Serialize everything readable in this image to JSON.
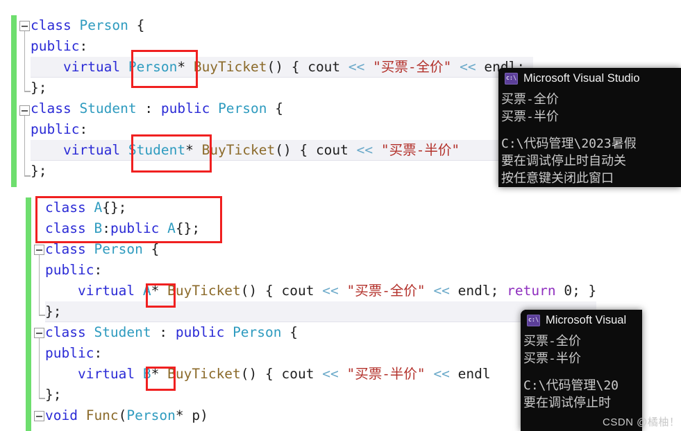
{
  "editor": {
    "block_top": {
      "lines": [
        {
          "id": "l1",
          "segments": [
            {
              "t": "class ",
              "c": "kw"
            },
            {
              "t": "Person",
              "c": "type"
            },
            {
              "t": " {",
              "c": "pn"
            }
          ]
        },
        {
          "id": "l2",
          "segments": [
            {
              "t": "public",
              "c": "kw"
            },
            {
              "t": ":",
              "c": "pn"
            }
          ]
        },
        {
          "id": "l3",
          "segments": [
            {
              "t": "    ",
              "c": "pn"
            },
            {
              "t": "virtual ",
              "c": "kw"
            },
            {
              "t": "Person",
              "c": "type"
            },
            {
              "t": "* ",
              "c": "pn"
            },
            {
              "t": "BuyTicket",
              "c": "fn"
            },
            {
              "t": "() { ",
              "c": "pn"
            },
            {
              "t": "cout",
              "c": "id"
            },
            {
              "t": " ",
              "c": "pn"
            },
            {
              "t": "<<",
              "c": "op"
            },
            {
              "t": " ",
              "c": "pn"
            },
            {
              "t": "\"买票-全价\"",
              "c": "str"
            },
            {
              "t": " ",
              "c": "pn"
            },
            {
              "t": "<<",
              "c": "op"
            },
            {
              "t": " ",
              "c": "pn"
            },
            {
              "t": "endl",
              "c": "id"
            },
            {
              "t": "; ",
              "c": "pn"
            }
          ]
        },
        {
          "id": "l4",
          "segments": [
            {
              "t": "};",
              "c": "pn"
            }
          ]
        },
        {
          "id": "l5",
          "segments": [
            {
              "t": "class ",
              "c": "kw"
            },
            {
              "t": "Student",
              "c": "type"
            },
            {
              "t": " : ",
              "c": "pn"
            },
            {
              "t": "public ",
              "c": "kw"
            },
            {
              "t": "Person",
              "c": "type"
            },
            {
              "t": " {",
              "c": "pn"
            }
          ]
        },
        {
          "id": "l6",
          "segments": [
            {
              "t": "public",
              "c": "kw"
            },
            {
              "t": ":",
              "c": "pn"
            }
          ]
        },
        {
          "id": "l7",
          "segments": [
            {
              "t": "    ",
              "c": "pn"
            },
            {
              "t": "virtual ",
              "c": "kw"
            },
            {
              "t": "Student",
              "c": "type"
            },
            {
              "t": "* ",
              "c": "pn"
            },
            {
              "t": "BuyTicket",
              "c": "fn"
            },
            {
              "t": "() { ",
              "c": "pn"
            },
            {
              "t": "cout",
              "c": "id"
            },
            {
              "t": " ",
              "c": "pn"
            },
            {
              "t": "<<",
              "c": "op"
            },
            {
              "t": " ",
              "c": "pn"
            },
            {
              "t": "\"买票-半价\"",
              "c": "str"
            }
          ]
        },
        {
          "id": "l8",
          "segments": [
            {
              "t": "};",
              "c": "pn"
            }
          ]
        }
      ]
    },
    "block_bottom": {
      "lines": [
        {
          "id": "b1",
          "segments": [
            {
              "t": "class ",
              "c": "kw"
            },
            {
              "t": "A",
              "c": "type"
            },
            {
              "t": "{};",
              "c": "pn"
            }
          ]
        },
        {
          "id": "b2",
          "segments": [
            {
              "t": "class ",
              "c": "kw"
            },
            {
              "t": "B",
              "c": "type"
            },
            {
              "t": ":",
              "c": "pn"
            },
            {
              "t": "public ",
              "c": "kw"
            },
            {
              "t": "A",
              "c": "type"
            },
            {
              "t": "{};",
              "c": "pn"
            }
          ]
        },
        {
          "id": "b3",
          "segments": [
            {
              "t": "class ",
              "c": "kw"
            },
            {
              "t": "Person",
              "c": "type"
            },
            {
              "t": " {",
              "c": "pn"
            }
          ]
        },
        {
          "id": "b4",
          "segments": [
            {
              "t": "public",
              "c": "kw"
            },
            {
              "t": ":",
              "c": "pn"
            }
          ]
        },
        {
          "id": "b5",
          "segments": [
            {
              "t": "    ",
              "c": "pn"
            },
            {
              "t": "virtual ",
              "c": "kw"
            },
            {
              "t": "A",
              "c": "type"
            },
            {
              "t": "* ",
              "c": "pn"
            },
            {
              "t": "BuyTicket",
              "c": "fn"
            },
            {
              "t": "() { ",
              "c": "pn"
            },
            {
              "t": "cout",
              "c": "id"
            },
            {
              "t": " ",
              "c": "pn"
            },
            {
              "t": "<<",
              "c": "op"
            },
            {
              "t": " ",
              "c": "pn"
            },
            {
              "t": "\"买票-全价\"",
              "c": "str"
            },
            {
              "t": " ",
              "c": "pn"
            },
            {
              "t": "<<",
              "c": "op"
            },
            {
              "t": " ",
              "c": "pn"
            },
            {
              "t": "endl",
              "c": "id"
            },
            {
              "t": "; ",
              "c": "pn"
            },
            {
              "t": "return ",
              "c": "ctl"
            },
            {
              "t": "0",
              "c": "num"
            },
            {
              "t": "; }",
              "c": "pn"
            }
          ]
        },
        {
          "id": "b6",
          "segments": [
            {
              "t": "};",
              "c": "pn"
            }
          ]
        },
        {
          "id": "b7",
          "segments": [
            {
              "t": "class ",
              "c": "kw"
            },
            {
              "t": "Student",
              "c": "type"
            },
            {
              "t": " : ",
              "c": "pn"
            },
            {
              "t": "public ",
              "c": "kw"
            },
            {
              "t": "Person",
              "c": "type"
            },
            {
              "t": " {",
              "c": "pn"
            }
          ]
        },
        {
          "id": "b8",
          "segments": [
            {
              "t": "public",
              "c": "kw"
            },
            {
              "t": ":",
              "c": "pn"
            }
          ]
        },
        {
          "id": "b9",
          "segments": [
            {
              "t": "    ",
              "c": "pn"
            },
            {
              "t": "virtual ",
              "c": "kw"
            },
            {
              "t": "B",
              "c": "type"
            },
            {
              "t": "* ",
              "c": "pn"
            },
            {
              "t": "BuyTicket",
              "c": "fn"
            },
            {
              "t": "() { ",
              "c": "pn"
            },
            {
              "t": "cout",
              "c": "id"
            },
            {
              "t": " ",
              "c": "pn"
            },
            {
              "t": "<<",
              "c": "op"
            },
            {
              "t": " ",
              "c": "pn"
            },
            {
              "t": "\"买票-半价\"",
              "c": "str"
            },
            {
              "t": " ",
              "c": "pn"
            },
            {
              "t": "<<",
              "c": "op"
            },
            {
              "t": " ",
              "c": "pn"
            },
            {
              "t": "endl",
              "c": "id"
            }
          ]
        },
        {
          "id": "b10",
          "segments": [
            {
              "t": "};",
              "c": "pn"
            }
          ]
        },
        {
          "id": "b11",
          "segments": [
            {
              "t": "void ",
              "c": "kw"
            },
            {
              "t": "Func",
              "c": "fn"
            },
            {
              "t": "(",
              "c": "pn"
            },
            {
              "t": "Person",
              "c": "type"
            },
            {
              "t": "* p)",
              "c": "pn"
            }
          ]
        }
      ]
    }
  },
  "consoles": [
    {
      "name": "console-top",
      "title": "Microsoft Visual Studio",
      "icon": "console-window-icon",
      "icon_glyph": "c:\\",
      "lines": [
        "买票-全价",
        "买票-半价",
        "",
        "C:\\代码管理\\2023暑假",
        "要在调试停止时自动关",
        "按任意键关闭此窗口"
      ]
    },
    {
      "name": "console-bottom",
      "title": "Microsoft Visual",
      "icon": "console-window-icon",
      "icon_glyph": "c:\\",
      "lines": [
        "买票-全价",
        "买票-半价",
        "",
        "C:\\代码管理\\20",
        "要在调试停止时"
      ]
    }
  ],
  "annotations": {
    "boxes": [
      {
        "name": "highlight-box-person-ptr"
      },
      {
        "name": "highlight-box-student-ptr"
      },
      {
        "name": "highlight-box-class-ab"
      },
      {
        "name": "highlight-box-a-ptr"
      },
      {
        "name": "highlight-box-b-ptr"
      }
    ],
    "box_color": "#f02020"
  },
  "watermark": {
    "text": "CSDN @橘柚！"
  }
}
